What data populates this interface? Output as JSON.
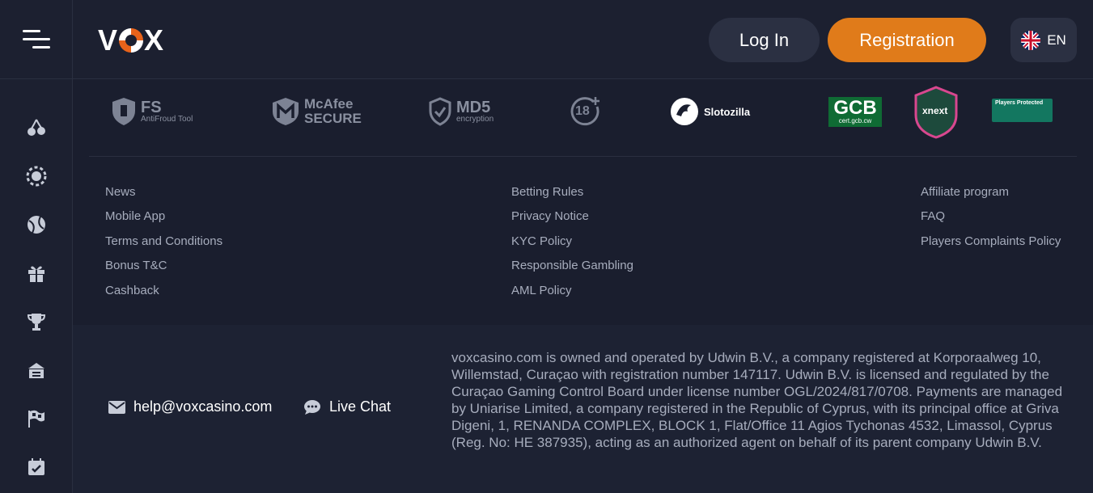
{
  "header": {
    "logo_text_left": "V",
    "logo_text_right": "X",
    "login_label": "Log In",
    "register_label": "Registration",
    "language": "EN"
  },
  "colors": {
    "accent": "#e07b1a",
    "background": "#1a1e2e",
    "panel": "#1c2030"
  },
  "sidebar": {
    "icons": [
      "cherries-icon",
      "chip-icon",
      "ball-icon",
      "gift-icon",
      "trophy-icon",
      "casino-icon",
      "race-flag-icon",
      "calendar-icon"
    ]
  },
  "partners": {
    "fs_title": "FS",
    "fs_subtitle": "AntiFroud Tool",
    "mcafee_line1": "McAfee",
    "mcafee_line2": "SECURE",
    "md5_title": "MD5",
    "md5_subtitle": "encryption",
    "age": "18",
    "slotozilla": "Slotozilla",
    "gcb_title": "GCB",
    "gcb_subtitle": "cert.gcb.cw",
    "xnext": "xnext",
    "players_protected": "Players Protected"
  },
  "links": {
    "col1": [
      "News",
      "Mobile App",
      "Terms and Conditions",
      "Bonus T&C",
      "Cashback"
    ],
    "col2": [
      "Betting Rules",
      "Privacy Notice",
      "KYC Policy",
      "Responsible Gambling",
      "AML Policy"
    ],
    "col3": [
      "Affiliate program",
      "FAQ",
      "Players Complaints Policy"
    ]
  },
  "contact": {
    "email": "help@voxcasino.com",
    "live_chat": "Live Chat"
  },
  "legal": "voxcasino.com is owned and operated by Udwin B.V., a company registered at Korporaalweg 10, Willemstad, Curaçao with registration number 147117. Udwin B.V. is licensed and regulated by the Curaçao Gaming Control Board under license number OGL/2024/817/0708. Payments are managed by Uniarise Limited, a company registered in the Republic of Cyprus, with its principal office at Griva Digeni, 1, RENANDA COMPLEX, BLOCK 1, Flat/Office 11 Agios Tychonas 4532, Limassol, Cyprus (Reg. No: HE 387935), acting as an authorized agent on behalf of its parent company Udwin B.V."
}
